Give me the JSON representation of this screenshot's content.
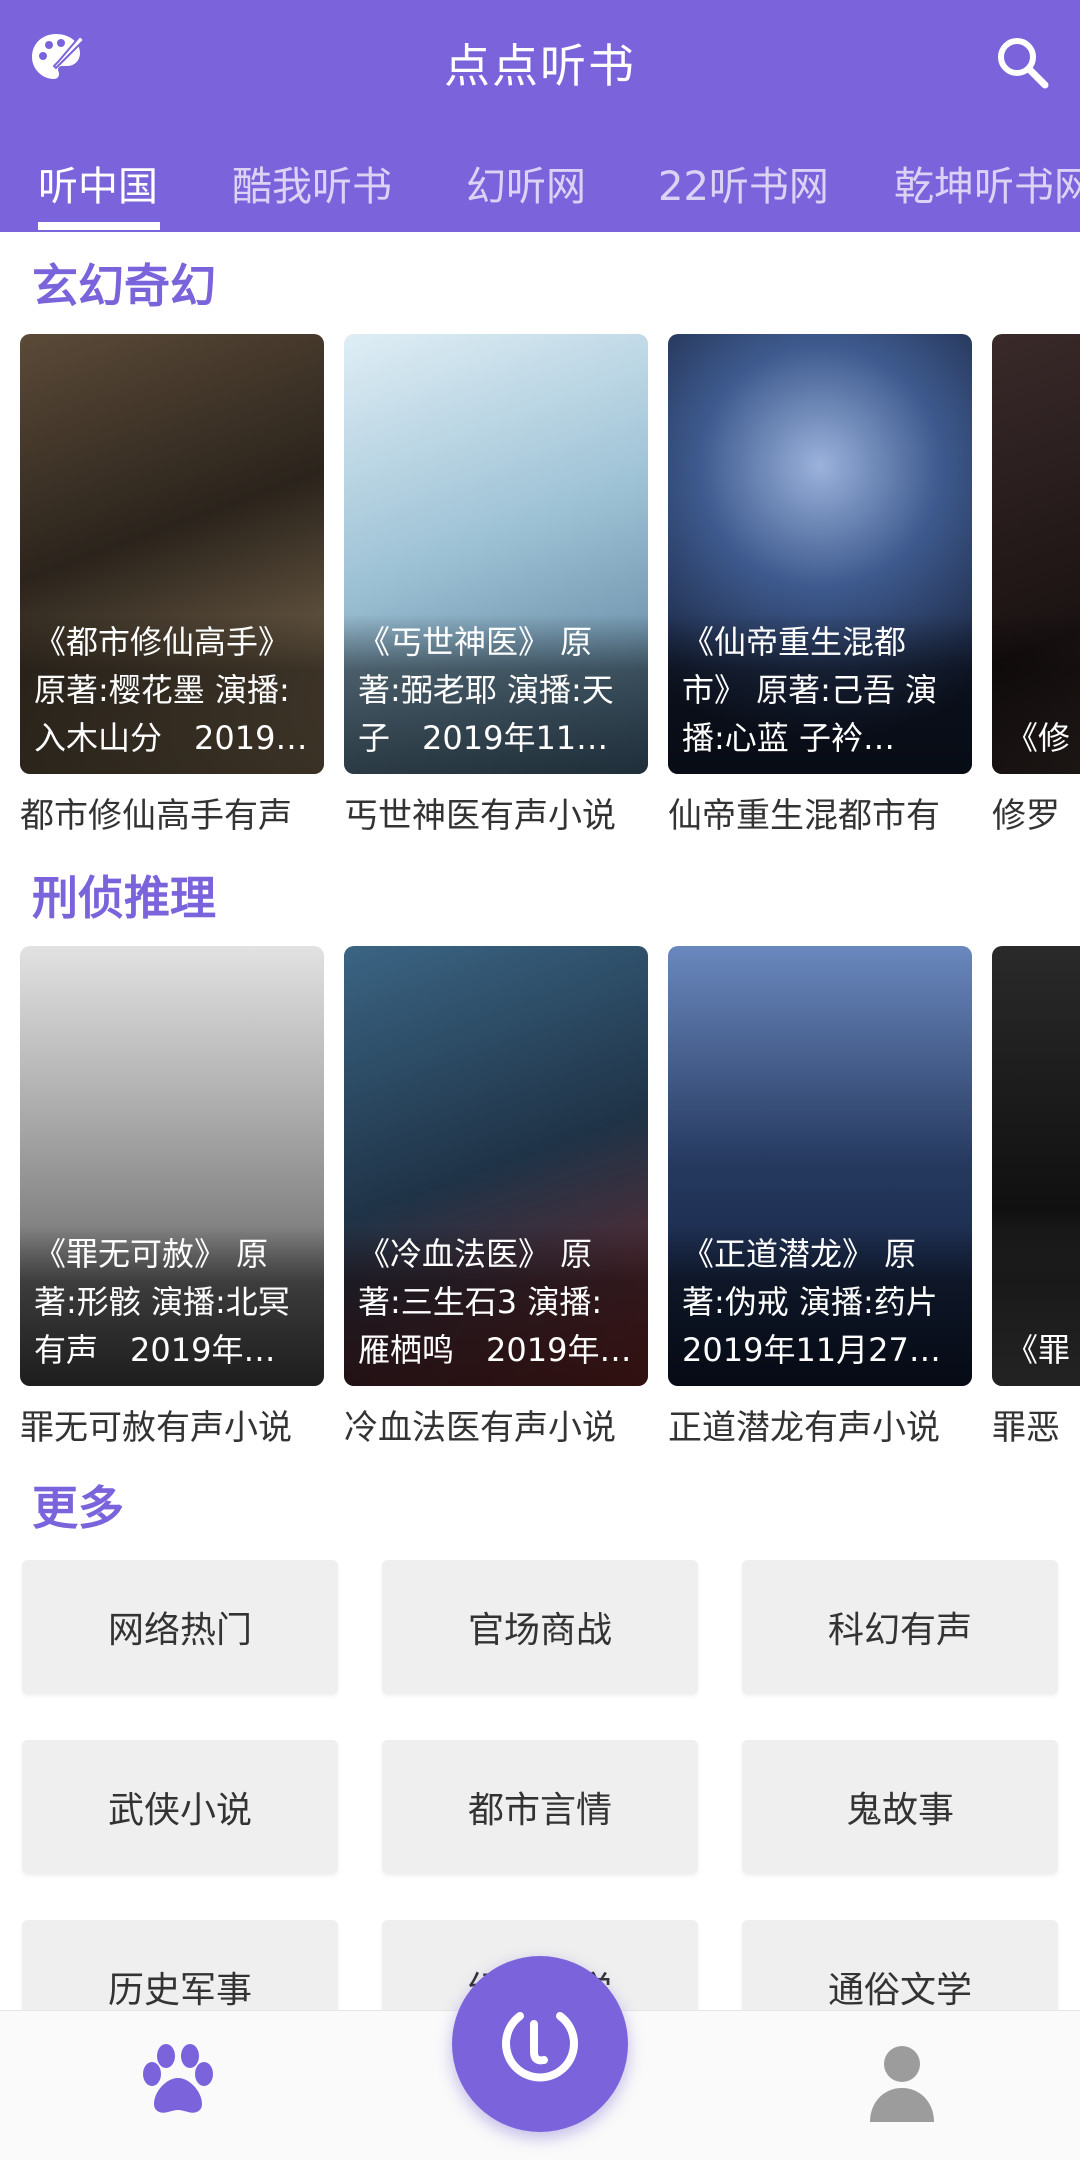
{
  "app": {
    "title": "点点听书"
  },
  "tabs": [
    "听中国",
    "酷我听书",
    "幻听网",
    "22听书网",
    "乾坤听书网"
  ],
  "sections": [
    {
      "title": "玄幻奇幻",
      "books": [
        {
          "desc": "《都市修仙高手》 原著:樱花墨 演播:入木山分　2019…",
          "name": "都市修仙高手有声",
          "colors": [
            "#3a2f25",
            "#8a7a60"
          ]
        },
        {
          "desc": "《丐世神医》 原著:弼老耶 演播:天子　2019年11月…",
          "name": "丐世神医有声小说",
          "colors": [
            "#bcd7e6",
            "#5a7f96"
          ]
        },
        {
          "desc": "《仙帝重生混都市》 原著:己吾 演播:心蓝 子衿陌　…",
          "name": "仙帝重生混都市有",
          "colors": [
            "#1e2a47",
            "#6f8ab5"
          ]
        },
        {
          "desc": "《修 著:实 播:相",
          "name": "修罗",
          "colors": [
            "#2a2020",
            "#5a4a44"
          ]
        }
      ]
    },
    {
      "title": "刑侦推理",
      "books": [
        {
          "desc": "《罪无可赦》 原著:形骸 演播:北冥有声　2019年11…",
          "name": "罪无可赦有声小说",
          "colors": [
            "#d9d9d9",
            "#3b3b3b"
          ]
        },
        {
          "desc": "《冷血法医》 原著:三生石3 演播:雁栖鸣　2019年…",
          "name": "冷血法医有声小说",
          "colors": [
            "#2d4f6e",
            "#8a3030"
          ]
        },
        {
          "desc": "《正道潜龙》 原著:伪戒 演播:药片 2019年11月27日…",
          "name": "正道潜龙有声小说",
          "colors": [
            "#1b2d52",
            "#4e6fa3"
          ]
        },
        {
          "desc": "《罪 著:实 漠之",
          "name": "罪恶",
          "colors": [
            "#1a1a1a",
            "#555555"
          ]
        }
      ]
    }
  ],
  "more": {
    "title": "更多",
    "items": [
      "网络热门",
      "官场商战",
      "科幻有声",
      "武侠小说",
      "都市言情",
      "鬼故事",
      "历史军事",
      "经典文学",
      "通俗文学"
    ]
  },
  "colors": {
    "accent": "#7b63db"
  }
}
